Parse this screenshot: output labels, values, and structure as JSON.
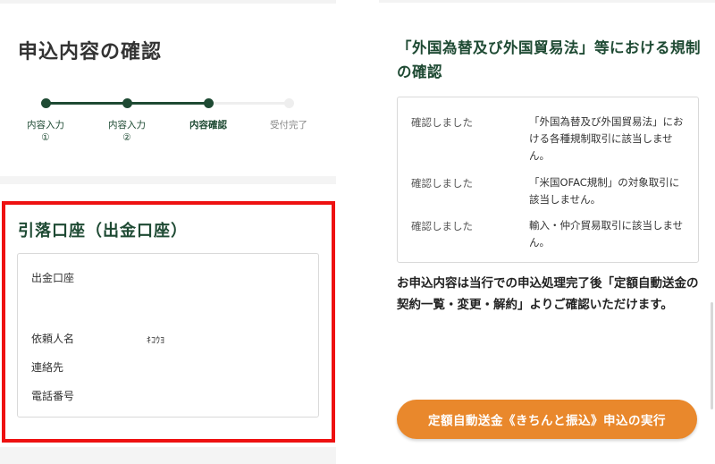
{
  "left": {
    "title": "申込内容の確認",
    "stepper": {
      "steps": [
        {
          "label": "内容入力",
          "sub": "①",
          "state": "done"
        },
        {
          "label": "内容入力",
          "sub": "②",
          "state": "done"
        },
        {
          "label": "内容確認",
          "sub": "",
          "state": "current"
        },
        {
          "label": "受付完了",
          "sub": "",
          "state": "inactive"
        }
      ]
    },
    "account_section": {
      "title": "引落口座（出金口座）",
      "fields": [
        {
          "label": "出金口座",
          "value": ""
        },
        {
          "label": "依頼人名",
          "value": "ｷｺｳﾖ"
        },
        {
          "label": "連絡先",
          "value": ""
        },
        {
          "label": "電話番号",
          "value": ""
        }
      ]
    }
  },
  "right": {
    "regulation": {
      "title": "「外国為替及び外国貿易法」等における規制の確認",
      "rows": [
        {
          "status": "確認しました",
          "text": "「外国為替及び外国貿易法」における各種規制取引に該当しません。"
        },
        {
          "status": "確認しました",
          "text": "「米国OFAC規制」の対象取引に該当しません。"
        },
        {
          "status": "確認しました",
          "text": "輸入・仲介貿易取引に該当しません。"
        }
      ]
    },
    "note": "お申込内容は当行での申込処理完了後「定額自動送金の契約一覧・変更・解約」よりご確認いただけます。",
    "execute_button_label": "定額自動送金《きちんと振込》申込の実行"
  },
  "colors": {
    "brand_green": "#1e4a33",
    "accent_orange": "#e9882c",
    "highlight_red": "#ee1111"
  }
}
